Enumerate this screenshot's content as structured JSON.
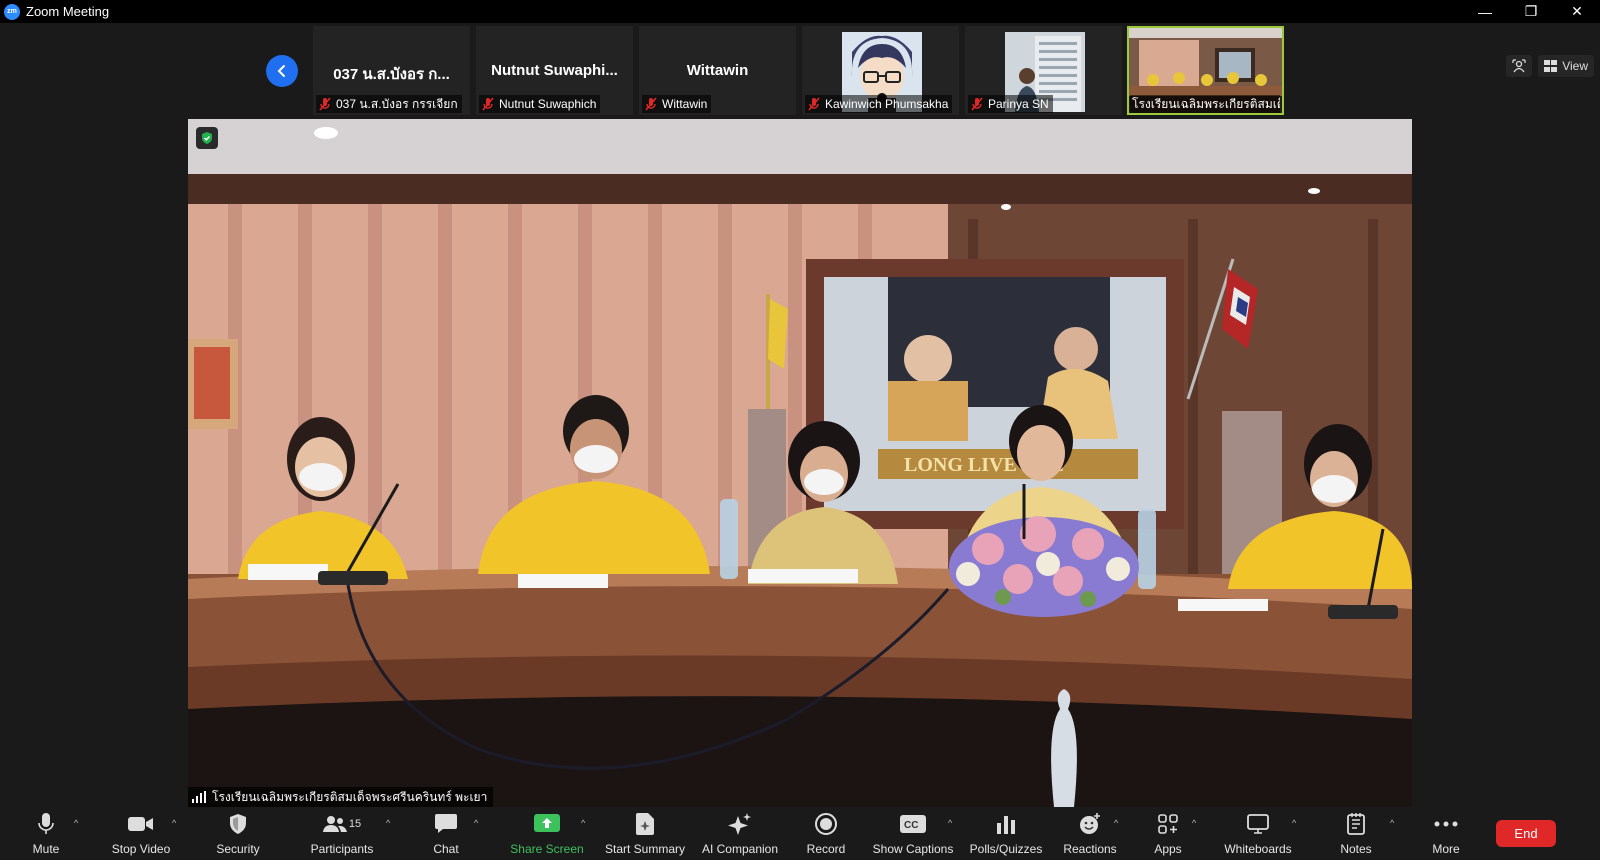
{
  "window": {
    "title": "Zoom Meeting",
    "logo_text": "zm",
    "minimize": "—",
    "restore": "❐",
    "close": "✕"
  },
  "gallery": {
    "thumbnails": [
      {
        "display_name": "037 น.ส.บังอร  ก...",
        "label": "037 น.ส.บังอร  กรรเจียก"
      },
      {
        "display_name": "Nutnut  Suwaphi...",
        "label": "Nutnut Suwaphich"
      },
      {
        "display_name": "Wittawin",
        "label": "Wittawin"
      },
      {
        "display_name": "",
        "label": "Kawinwich Phumsakha"
      },
      {
        "display_name": "",
        "label": "Parinya SN"
      },
      {
        "display_name": "",
        "label": "โรงเรียนเฉลิมพระเกียรติสมเด็..."
      }
    ]
  },
  "top_tools": {
    "view_label": "View"
  },
  "main_video": {
    "speaker_label": "โรงเรียนเฉลิมพระเกียรติสมเด็จพระศรีนครินทร์ พะเยา",
    "banner_text": "LONG LIVE THE"
  },
  "toolbar": {
    "mute": "Mute",
    "stop_video": "Stop Video",
    "security": "Security",
    "participants": "Participants",
    "participants_count": "15",
    "chat": "Chat",
    "share_screen": "Share Screen",
    "start_summary": "Start Summary",
    "ai_companion": "AI Companion",
    "record": "Record",
    "show_captions": "Show Captions",
    "polls": "Polls/Quizzes",
    "reactions": "Reactions",
    "apps": "Apps",
    "whiteboards": "Whiteboards",
    "notes": "Notes",
    "more": "More",
    "end": "End",
    "cc_text": "CC"
  },
  "colors": {
    "accent_blue": "#1f6ff0",
    "share_green": "#3cc15c",
    "end_red": "#e02828",
    "active_border": "#9bcb3c"
  }
}
